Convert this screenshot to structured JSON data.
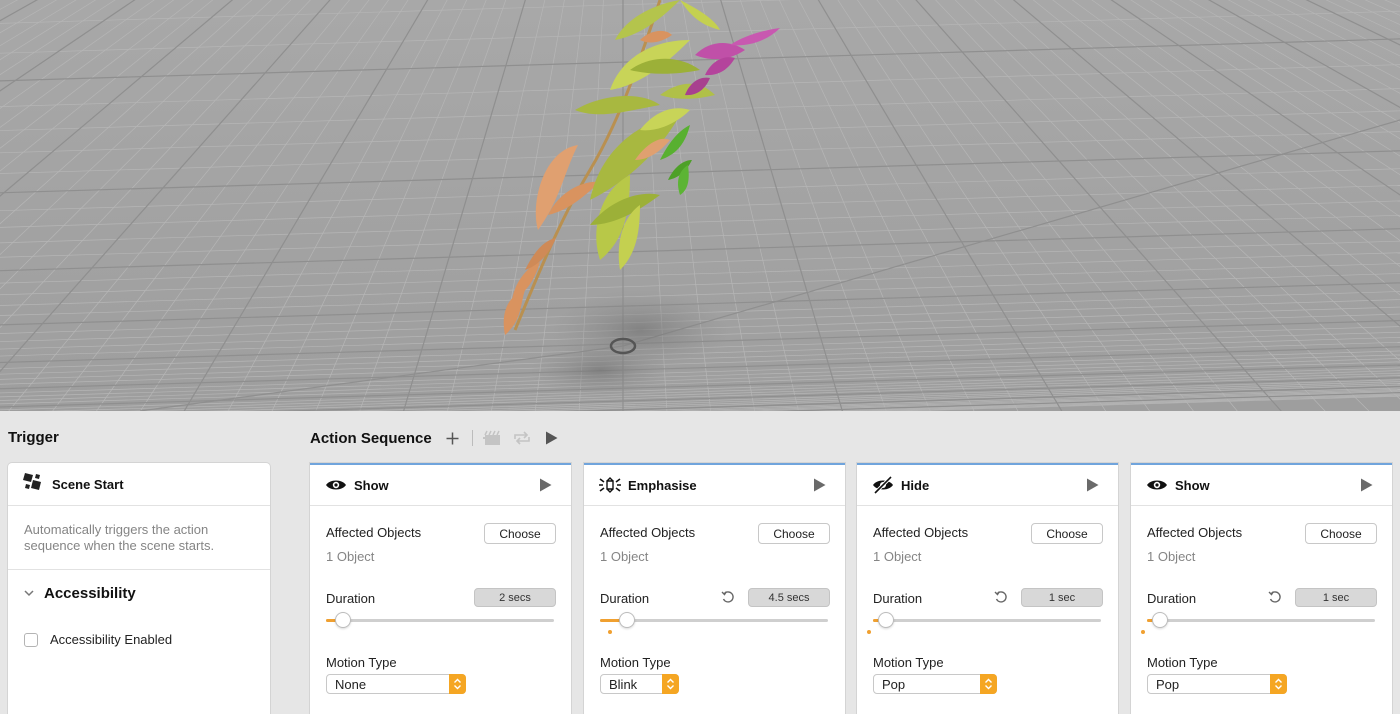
{
  "viewport": {
    "label": "3D scene viewport"
  },
  "trigger": {
    "section_title": "Trigger",
    "card_title": "Scene Start",
    "description": "Automatically triggers the action sequence when the scene starts.",
    "accessibility_title": "Accessibility",
    "accessibility_checkbox_label": "Accessibility Enabled",
    "accessibility_enabled": false
  },
  "sequence": {
    "section_title": "Action Sequence",
    "toolbar": [
      "add-icon",
      "clapboard-icon",
      "loop-icon",
      "play-icon"
    ]
  },
  "actions": [
    {
      "title": "Show",
      "icon": "eye-icon",
      "affected_label": "Affected Objects",
      "affected_count": "1 Object",
      "choose_label": "Choose",
      "duration_label": "Duration",
      "duration_value": "2 secs",
      "duration_reset": false,
      "duration_fraction": 0.075,
      "motion_label": "Motion Type",
      "motion_value": "None"
    },
    {
      "title": "Emphasise",
      "icon": "emphasise-icon",
      "affected_label": "Affected Objects",
      "affected_count": "1 Object",
      "choose_label": "Choose",
      "duration_label": "Duration",
      "duration_value": "4.5 secs",
      "duration_reset": true,
      "duration_fraction": 0.12,
      "motion_label": "Motion Type",
      "motion_value": "Blink"
    },
    {
      "title": "Hide",
      "icon": "eye-slash-icon",
      "affected_label": "Affected Objects",
      "affected_count": "1 Object",
      "choose_label": "Choose",
      "duration_label": "Duration",
      "duration_value": "1 sec",
      "duration_reset": true,
      "duration_fraction": 0.055,
      "motion_label": "Motion Type",
      "motion_value": "Pop"
    },
    {
      "title": "Show",
      "icon": "eye-icon",
      "affected_label": "Affected Objects",
      "affected_count": "1 Object",
      "choose_label": "Choose",
      "duration_label": "Duration",
      "duration_value": "1 sec",
      "duration_reset": true,
      "duration_fraction": 0.055,
      "motion_label": "Motion Type",
      "motion_value": "Pop"
    }
  ],
  "colors": {
    "accent": "#f5a623",
    "card_top_border": "#70a4dc",
    "viewport_bg": "#a4a4a4"
  }
}
